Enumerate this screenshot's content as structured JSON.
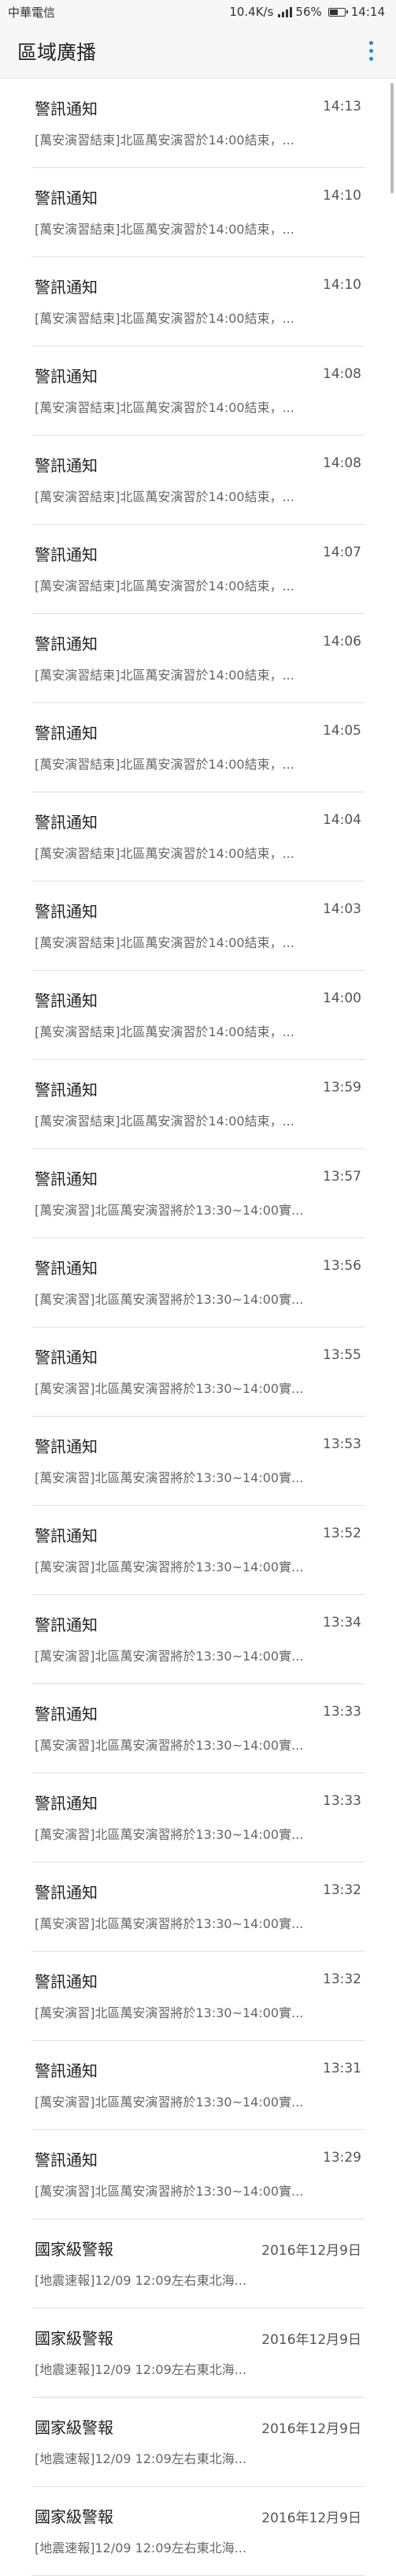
{
  "status_bar": {
    "carrier": "中華電信",
    "net_speed": "10.4K/s",
    "battery_percent": "56%",
    "battery_level": 0.56,
    "time": "14:14"
  },
  "app_bar": {
    "title": "區域廣播",
    "menu_icon": "more-vert-icon",
    "accent_color": "#1e88e5"
  },
  "messages": [
    {
      "title": "警訊通知",
      "time": "14:13",
      "preview": "[萬安演習結束]北區萬安演習於14:00結束，..."
    },
    {
      "title": "警訊通知",
      "time": "14:10",
      "preview": "[萬安演習結束]北區萬安演習於14:00結束，..."
    },
    {
      "title": "警訊通知",
      "time": "14:10",
      "preview": "[萬安演習結束]北區萬安演習於14:00結束，..."
    },
    {
      "title": "警訊通知",
      "time": "14:08",
      "preview": "[萬安演習結束]北區萬安演習於14:00結束，..."
    },
    {
      "title": "警訊通知",
      "time": "14:08",
      "preview": "[萬安演習結束]北區萬安演習於14:00結束，..."
    },
    {
      "title": "警訊通知",
      "time": "14:07",
      "preview": "[萬安演習結束]北區萬安演習於14:00結束，..."
    },
    {
      "title": "警訊通知",
      "time": "14:06",
      "preview": "[萬安演習結束]北區萬安演習於14:00結束，..."
    },
    {
      "title": "警訊通知",
      "time": "14:05",
      "preview": "[萬安演習結束]北區萬安演習於14:00結束，..."
    },
    {
      "title": "警訊通知",
      "time": "14:04",
      "preview": "[萬安演習結束]北區萬安演習於14:00結束，..."
    },
    {
      "title": "警訊通知",
      "time": "14:03",
      "preview": "[萬安演習結束]北區萬安演習於14:00結束，..."
    },
    {
      "title": "警訊通知",
      "time": "14:00",
      "preview": "[萬安演習結束]北區萬安演習於14:00結束，..."
    },
    {
      "title": "警訊通知",
      "time": "13:59",
      "preview": "[萬安演習結束]北區萬安演習於14:00結束，..."
    },
    {
      "title": "警訊通知",
      "time": "13:57",
      "preview": "[萬安演習]北區萬安演習將於13:30~14:00實..."
    },
    {
      "title": "警訊通知",
      "time": "13:56",
      "preview": "[萬安演習]北區萬安演習將於13:30~14:00實..."
    },
    {
      "title": "警訊通知",
      "time": "13:55",
      "preview": "[萬安演習]北區萬安演習將於13:30~14:00實..."
    },
    {
      "title": "警訊通知",
      "time": "13:53",
      "preview": "[萬安演習]北區萬安演習將於13:30~14:00實..."
    },
    {
      "title": "警訊通知",
      "time": "13:52",
      "preview": "[萬安演習]北區萬安演習將於13:30~14:00實..."
    },
    {
      "title": "警訊通知",
      "time": "13:34",
      "preview": "[萬安演習]北區萬安演習將於13:30~14:00實..."
    },
    {
      "title": "警訊通知",
      "time": "13:33",
      "preview": "[萬安演習]北區萬安演習將於13:30~14:00實..."
    },
    {
      "title": "警訊通知",
      "time": "13:33",
      "preview": "[萬安演習]北區萬安演習將於13:30~14:00實..."
    },
    {
      "title": "警訊通知",
      "time": "13:32",
      "preview": "[萬安演習]北區萬安演習將於13:30~14:00實..."
    },
    {
      "title": "警訊通知",
      "time": "13:32",
      "preview": "[萬安演習]北區萬安演習將於13:30~14:00實..."
    },
    {
      "title": "警訊通知",
      "time": "13:31",
      "preview": "[萬安演習]北區萬安演習將於13:30~14:00實..."
    },
    {
      "title": "警訊通知",
      "time": "13:29",
      "preview": "[萬安演習]北區萬安演習將於13:30~14:00實..."
    },
    {
      "title": "國家級警報",
      "time": "2016年12月9日",
      "preview": "[地震速報]12/09 12:09左右東北海..."
    },
    {
      "title": "國家級警報",
      "time": "2016年12月9日",
      "preview": "[地震速報]12/09 12:09左右東北海..."
    },
    {
      "title": "國家級警報",
      "time": "2016年12月9日",
      "preview": "[地震速報]12/09 12:09左右東北海..."
    },
    {
      "title": "國家級警報",
      "time": "2016年12月9日",
      "preview": "[地震速報]12/09 12:09左右東北海..."
    }
  ]
}
